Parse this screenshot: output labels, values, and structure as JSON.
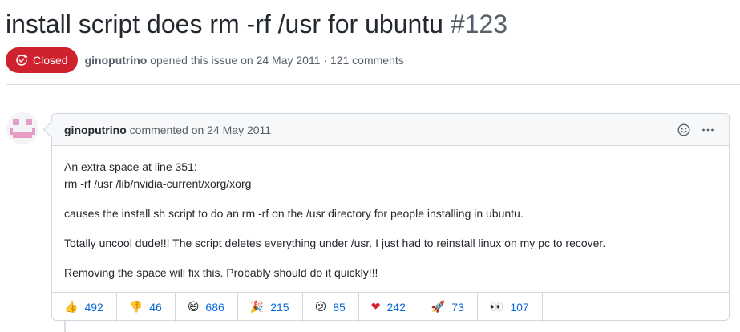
{
  "issue": {
    "title": "install script does rm -rf /usr for ubuntu",
    "number": "#123",
    "state": "Closed",
    "author": "ginoputrino",
    "opened_text": "opened this issue on 24 May 2011 · 121 comments"
  },
  "comment": {
    "author": "ginoputrino",
    "meta": "commented on 24 May 2011",
    "body": [
      "An extra space at line 351:",
      "rm -rf /usr /lib/nvidia-current/xorg/xorg",
      "causes the install.sh script to do an rm -rf on the /usr directory for people installing in ubuntu.",
      "Totally uncool dude!!! The script deletes everything under /usr. I just had to reinstall linux on my pc to recover.",
      "Removing the space will fix this. Probably should do it quickly!!!"
    ],
    "icons": [
      "smiley-icon",
      "kebab-menu-icon"
    ]
  },
  "reactions": [
    {
      "emoji": "👍",
      "name": "thumbs-up",
      "count": "492"
    },
    {
      "emoji": "👎",
      "name": "thumbs-down",
      "count": "46"
    },
    {
      "emoji": "😄",
      "name": "laugh",
      "count": "686"
    },
    {
      "emoji": "🎉",
      "name": "hooray",
      "count": "215"
    },
    {
      "emoji": "😕",
      "name": "confused",
      "count": "85"
    },
    {
      "emoji": "❤",
      "name": "heart",
      "count": "242"
    },
    {
      "emoji": "🚀",
      "name": "rocket",
      "count": "73"
    },
    {
      "emoji": "👀",
      "name": "eyes",
      "count": "107"
    }
  ],
  "colors": {
    "closed_badge": "#cf222e",
    "link": "#0969da",
    "border": "#d0d7de",
    "avatar_identicon": "#e59dc5"
  }
}
